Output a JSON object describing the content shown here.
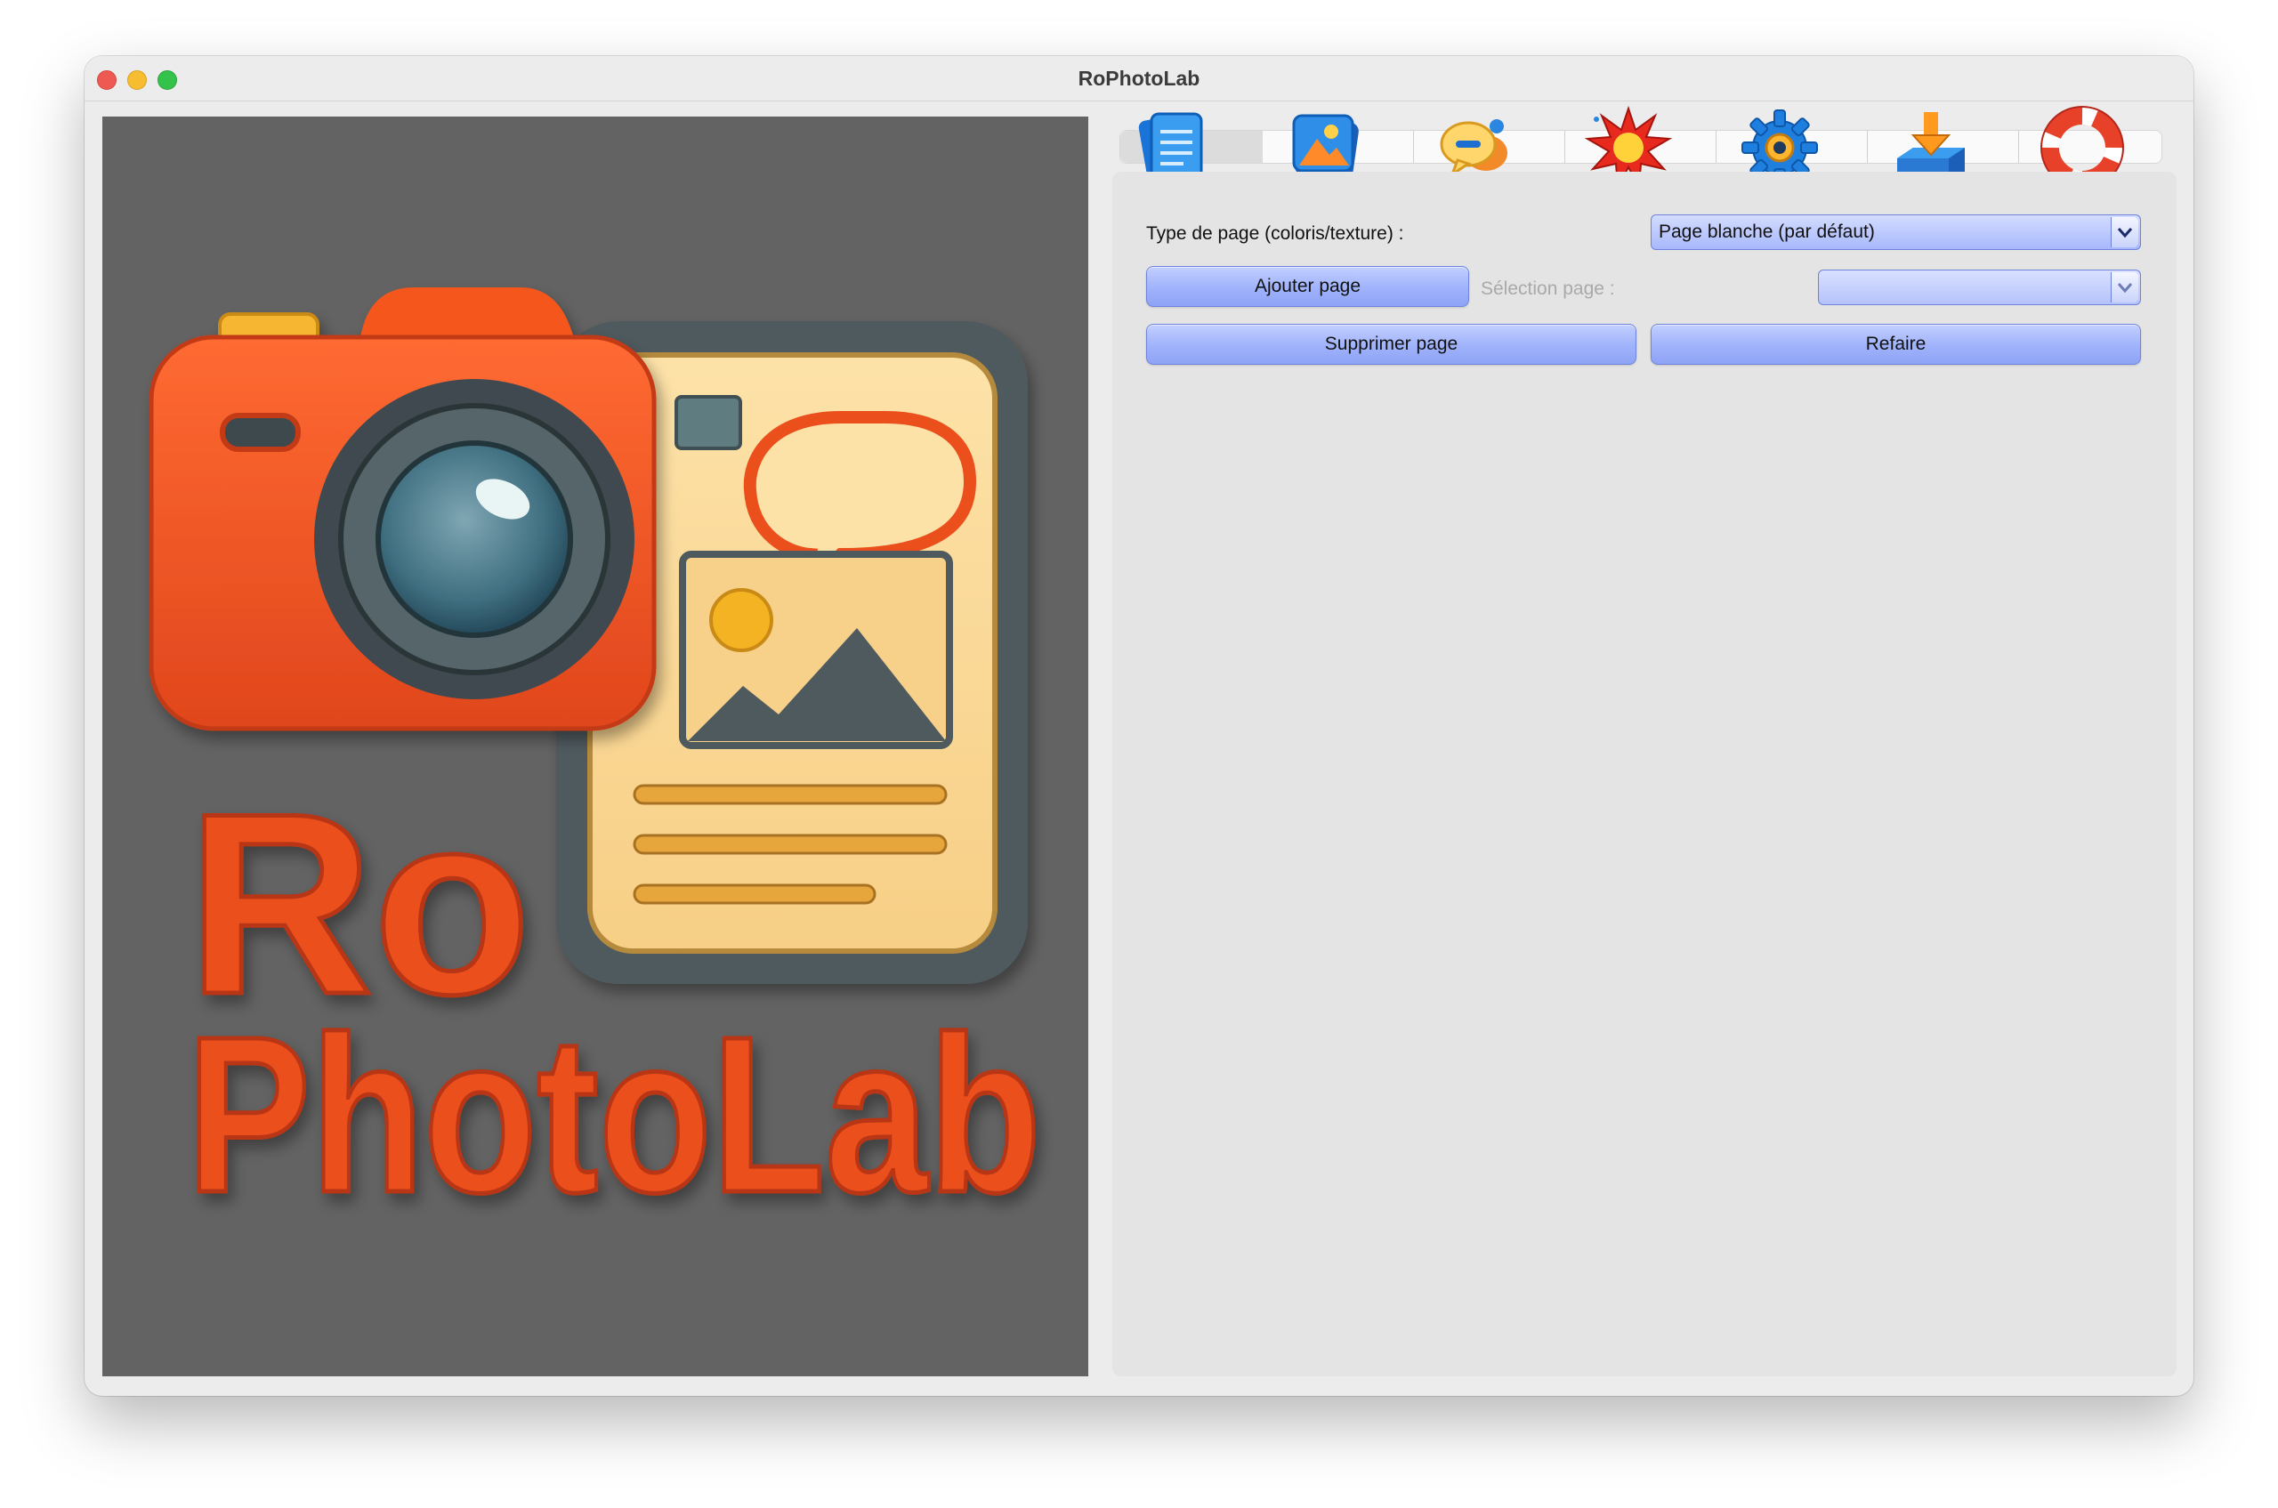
{
  "window": {
    "title": "RoPhotoLab"
  },
  "preview": {
    "logo_text_line1": "Ro",
    "logo_text_line2": "PhotoLab"
  },
  "toolbar": {
    "tools": [
      {
        "icon": "pages-icon"
      },
      {
        "icon": "image-icon"
      },
      {
        "icon": "speech-bubble-icon"
      },
      {
        "icon": "starburst-icon"
      },
      {
        "icon": "gear-icon"
      },
      {
        "icon": "download-tray-icon"
      },
      {
        "icon": "lifebuoy-icon"
      }
    ]
  },
  "panel": {
    "page_type_label": "Type de page (coloris/texture) :",
    "page_type_value": "Page blanche (par défaut)",
    "add_page_label": "Ajouter page",
    "page_selection_label": "Sélection page :",
    "page_selection_value": "",
    "delete_page_label": "Supprimer page",
    "redo_label": "Refaire"
  },
  "colors": {
    "button_blue": "#a3b5fb",
    "preview_bg": "#636363",
    "logo_orange": "#ea4f1e"
  }
}
